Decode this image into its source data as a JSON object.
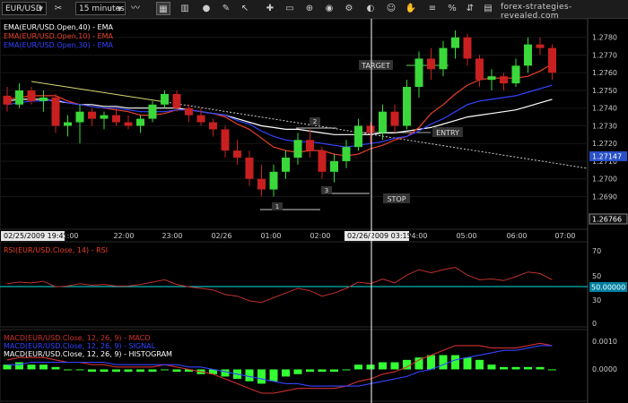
{
  "toolbar": {
    "symbol": "EUR/USD",
    "interval": "15 minutes",
    "site": "forex-strategies-revealed.com",
    "buttons": [
      "scissors-icon",
      "bar-chart-icon",
      "candles-icon",
      "line-chart-icon",
      "pin-icon",
      "cursor-icon",
      "crosshair-icon",
      "pencil-icon",
      "trash-icon",
      "image-icon",
      "zoom-icon",
      "gear-icon",
      "alarm-icon",
      "person-icon",
      "hand-icon",
      "bars-icon",
      "percent-icon",
      "up-down-arrows-icon",
      "grid-icon",
      "tree-icon"
    ]
  },
  "price_panel": {
    "legend": [
      "EMA(EUR/USD.Open,40) - EMA",
      "EMA(EUR/USD.Open,10) - EMA",
      "EMA(EUR/USD.Open,30) - EMA"
    ],
    "legend_colors": [
      "#ffffff",
      "#e8402a",
      "#3344ff"
    ],
    "current_price": "1.27147",
    "bottom_price": "1.26766",
    "annotations": {
      "target": "TARGET",
      "entry": "ENTRY",
      "stop": "STOP",
      "label1": "1",
      "label2": "2",
      "label3": "3"
    }
  },
  "time_axis": {
    "labels": [
      "21:00",
      "22:00",
      "23:00",
      "02/26",
      "01:00",
      "02:00",
      "04:00",
      "05:00",
      "06:00",
      "07:00"
    ],
    "start_box": "02/25/2009 19:45",
    "cursor_box": "02/26/2009 03:15"
  },
  "rsi_panel": {
    "title": "RSI(EUR/USD.Close, 14) - RSI",
    "ticks": [
      "70",
      "50",
      "30",
      "0"
    ],
    "level_value": "50.00000",
    "level_color": "#00e5e5"
  },
  "macd_panel": {
    "title_macd": "MACD(EUR/USD.Close, 12, 26, 9) - MACD",
    "title_signal": "MACD(EUR/USD.Close, 12, 26, 9) - SIGNAL",
    "title_hist": "MACD(EUR/USD.Close, 12, 26, 9) - HISTOGRAM",
    "ticks": [
      "0.0010",
      "0.0000"
    ],
    "colors": {
      "macd": "#d03030",
      "signal": "#3344ff",
      "histogram": "#33ff33"
    }
  },
  "chart_data": [
    {
      "type": "candlestick",
      "title": "EUR/USD",
      "ylim": [
        1.2672,
        1.279
      ],
      "y_ticks": [
        1.269,
        1.27,
        1.271,
        1.272,
        1.273,
        1.274,
        1.275,
        1.276,
        1.277,
        1.278
      ],
      "candles": [
        {
          "o": 1.2747,
          "h": 1.2752,
          "l": 1.2738,
          "c": 1.2742
        },
        {
          "o": 1.2742,
          "h": 1.2754,
          "l": 1.274,
          "c": 1.275
        },
        {
          "o": 1.275,
          "h": 1.2752,
          "l": 1.2742,
          "c": 1.2744
        },
        {
          "o": 1.2744,
          "h": 1.275,
          "l": 1.2738,
          "c": 1.2746
        },
        {
          "o": 1.2746,
          "h": 1.2748,
          "l": 1.2726,
          "c": 1.273
        },
        {
          "o": 1.273,
          "h": 1.2736,
          "l": 1.2724,
          "c": 1.2732
        },
        {
          "o": 1.2732,
          "h": 1.2742,
          "l": 1.272,
          "c": 1.2738
        },
        {
          "o": 1.2738,
          "h": 1.274,
          "l": 1.273,
          "c": 1.2734
        },
        {
          "o": 1.2734,
          "h": 1.2738,
          "l": 1.2728,
          "c": 1.2736
        },
        {
          "o": 1.2736,
          "h": 1.274,
          "l": 1.273,
          "c": 1.2732
        },
        {
          "o": 1.2732,
          "h": 1.2736,
          "l": 1.2728,
          "c": 1.273
        },
        {
          "o": 1.273,
          "h": 1.2736,
          "l": 1.2726,
          "c": 1.2734
        },
        {
          "o": 1.2734,
          "h": 1.2744,
          "l": 1.2732,
          "c": 1.2742
        },
        {
          "o": 1.2742,
          "h": 1.275,
          "l": 1.274,
          "c": 1.2748
        },
        {
          "o": 1.2748,
          "h": 1.275,
          "l": 1.2738,
          "c": 1.274
        },
        {
          "o": 1.274,
          "h": 1.2742,
          "l": 1.2732,
          "c": 1.2736
        },
        {
          "o": 1.2736,
          "h": 1.274,
          "l": 1.273,
          "c": 1.2732
        },
        {
          "o": 1.2732,
          "h": 1.2734,
          "l": 1.2724,
          "c": 1.2728
        },
        {
          "o": 1.2728,
          "h": 1.273,
          "l": 1.2712,
          "c": 1.2716
        },
        {
          "o": 1.2716,
          "h": 1.2722,
          "l": 1.2708,
          "c": 1.2712
        },
        {
          "o": 1.2712,
          "h": 1.2716,
          "l": 1.2696,
          "c": 1.27
        },
        {
          "o": 1.27,
          "h": 1.2708,
          "l": 1.269,
          "c": 1.2694
        },
        {
          "o": 1.2694,
          "h": 1.2708,
          "l": 1.269,
          "c": 1.2704
        },
        {
          "o": 1.2704,
          "h": 1.2716,
          "l": 1.27,
          "c": 1.2712
        },
        {
          "o": 1.2712,
          "h": 1.2726,
          "l": 1.2708,
          "c": 1.2722
        },
        {
          "o": 1.2722,
          "h": 1.2728,
          "l": 1.2712,
          "c": 1.2716
        },
        {
          "o": 1.2716,
          "h": 1.2718,
          "l": 1.27,
          "c": 1.2704
        },
        {
          "o": 1.2704,
          "h": 1.2714,
          "l": 1.2698,
          "c": 1.271
        },
        {
          "o": 1.271,
          "h": 1.2722,
          "l": 1.2706,
          "c": 1.2718
        },
        {
          "o": 1.2718,
          "h": 1.2734,
          "l": 1.2716,
          "c": 1.273
        },
        {
          "o": 1.273,
          "h": 1.2732,
          "l": 1.272,
          "c": 1.2726
        },
        {
          "o": 1.2726,
          "h": 1.2742,
          "l": 1.2722,
          "c": 1.2738
        },
        {
          "o": 1.2738,
          "h": 1.2742,
          "l": 1.2726,
          "c": 1.273
        },
        {
          "o": 1.273,
          "h": 1.2756,
          "l": 1.2728,
          "c": 1.2752
        },
        {
          "o": 1.2752,
          "h": 1.2772,
          "l": 1.2746,
          "c": 1.2768
        },
        {
          "o": 1.2768,
          "h": 1.2774,
          "l": 1.2756,
          "c": 1.2762
        },
        {
          "o": 1.2762,
          "h": 1.2778,
          "l": 1.2758,
          "c": 1.2774
        },
        {
          "o": 1.2774,
          "h": 1.2784,
          "l": 1.2768,
          "c": 1.278
        },
        {
          "o": 1.278,
          "h": 1.2782,
          "l": 1.2764,
          "c": 1.2768
        },
        {
          "o": 1.2768,
          "h": 1.277,
          "l": 1.2752,
          "c": 1.2756
        },
        {
          "o": 1.2756,
          "h": 1.2762,
          "l": 1.275,
          "c": 1.2758
        },
        {
          "o": 1.2758,
          "h": 1.276,
          "l": 1.275,
          "c": 1.2754
        },
        {
          "o": 1.2754,
          "h": 1.2768,
          "l": 1.2752,
          "c": 1.2764
        },
        {
          "o": 1.2764,
          "h": 1.278,
          "l": 1.276,
          "c": 1.2776
        },
        {
          "o": 1.2776,
          "h": 1.278,
          "l": 1.277,
          "c": 1.2774
        },
        {
          "o": 1.2774,
          "h": 1.2776,
          "l": 1.2756,
          "c": 1.276
        }
      ],
      "series": [
        {
          "name": "EMA(EUR/USD.Open,40) - EMA",
          "values": [
            1.2744,
            1.2745,
            1.2745,
            1.2745,
            1.2744,
            1.2743,
            1.2742,
            1.2742,
            1.2741,
            1.2741,
            1.274,
            1.274,
            1.274,
            1.274,
            1.274,
            1.2739,
            1.2738,
            1.2737,
            1.2736,
            1.2734,
            1.2732,
            1.273,
            1.2729,
            1.2728,
            1.2728,
            1.2727,
            1.2726,
            1.2725,
            1.2725,
            1.2725,
            1.2725,
            1.2726,
            1.2726,
            1.2727,
            1.2728,
            1.2729,
            1.2731,
            1.2733,
            1.2735,
            1.2736,
            1.2737,
            1.2738,
            1.2739,
            1.2741,
            1.2743,
            1.2745
          ]
        },
        {
          "name": "EMA(EUR/USD.Open,10) - EMA",
          "values": [
            1.2745,
            1.2746,
            1.2747,
            1.2747,
            1.2747,
            1.2744,
            1.2742,
            1.2741,
            1.274,
            1.2739,
            1.2738,
            1.2736,
            1.2736,
            1.2737,
            1.2739,
            1.2739,
            1.2738,
            1.2737,
            1.2735,
            1.2731,
            1.2728,
            1.2723,
            1.2718,
            1.2716,
            1.2715,
            1.2716,
            1.2716,
            1.2714,
            1.2713,
            1.2714,
            1.2717,
            1.2719,
            1.2722,
            1.2724,
            1.2729,
            1.2737,
            1.2742,
            1.2748,
            1.2753,
            1.2756,
            1.2757,
            1.2757,
            1.2757,
            1.2758,
            1.2761,
            1.2765
          ]
        },
        {
          "name": "EMA(EUR/USD.Open,30) - EMA",
          "values": [
            1.2742,
            1.2743,
            1.2744,
            1.2744,
            1.2745,
            1.2743,
            1.2742,
            1.2741,
            1.274,
            1.274,
            1.2739,
            1.2738,
            1.2738,
            1.2738,
            1.2739,
            1.2739,
            1.2738,
            1.2737,
            1.2736,
            1.2733,
            1.2731,
            1.2727,
            1.2724,
            1.2722,
            1.2721,
            1.2721,
            1.272,
            1.2719,
            1.2718,
            1.2719,
            1.272,
            1.2721,
            1.2723,
            1.2724,
            1.2727,
            1.2731,
            1.2734,
            1.2738,
            1.2742,
            1.2744,
            1.2745,
            1.2746,
            1.2747,
            1.2749,
            1.2751,
            1.2753
          ]
        }
      ]
    },
    {
      "type": "line",
      "title": "RSI(EUR/USD.Close, 14) - RSI",
      "ylim": [
        0,
        100
      ],
      "series": [
        {
          "name": "RSI(EUR/USD.Close, 14) - RSI",
          "values": [
            52,
            54,
            53,
            55,
            48,
            49,
            52,
            50,
            51,
            49,
            49,
            51,
            54,
            57,
            51,
            48,
            46,
            44,
            38,
            36,
            30,
            28,
            34,
            40,
            46,
            43,
            36,
            40,
            46,
            54,
            52,
            58,
            53,
            63,
            70,
            66,
            70,
            73,
            63,
            57,
            58,
            56,
            61,
            67,
            65,
            57
          ]
        }
      ]
    },
    {
      "type": "bar+line",
      "title": "MACD(EUR/USD.Close, 12, 26, 9)",
      "ylim": [
        -0.0013,
        0.0016
      ],
      "series": [
        {
          "name": "MACD(EUR/USD.Close, 12, 26, 9) - MACD",
          "values": [
            0.0004,
            0.0005,
            0.0005,
            0.0005,
            0.0004,
            0.0003,
            0.0003,
            0.0002,
            0.0002,
            0.0001,
            0.0001,
            0.0001,
            0.0001,
            0.0002,
            0.0001,
            0.0,
            -0.0001,
            -0.0002,
            -0.0004,
            -0.0006,
            -0.0008,
            -0.001,
            -0.001,
            -0.0009,
            -0.0008,
            -0.0008,
            -0.0008,
            -0.0008,
            -0.0007,
            -0.0005,
            -0.0004,
            -0.0002,
            -0.0001,
            0.0001,
            0.0004,
            0.0006,
            0.0008,
            0.001,
            0.001,
            0.001,
            0.0009,
            0.0009,
            0.0009,
            0.001,
            0.0011,
            0.001
          ]
        },
        {
          "name": "MACD(EUR/USD.Close, 12, 26, 9) - SIGNAL",
          "values": [
            0.0002,
            0.0002,
            0.0003,
            0.0003,
            0.0003,
            0.0003,
            0.0003,
            0.0003,
            0.0003,
            0.0002,
            0.0002,
            0.0002,
            0.0002,
            0.0002,
            0.0002,
            0.0001,
            0.0001,
            0.0,
            -0.0001,
            -0.0002,
            -0.0003,
            -0.0004,
            -0.0005,
            -0.0006,
            -0.0006,
            -0.0007,
            -0.0007,
            -0.0007,
            -0.0007,
            -0.0007,
            -0.0006,
            -0.0005,
            -0.0004,
            -0.0003,
            -0.0001,
            0.0,
            0.0002,
            0.0004,
            0.0005,
            0.0006,
            0.0007,
            0.0008,
            0.0008,
            0.0009,
            0.001,
            0.001
          ]
        },
        {
          "name": "MACD(EUR/USD.Close, 12, 26, 9) - HISTOGRAM",
          "values": [
            0.0002,
            0.0003,
            0.0002,
            0.0002,
            0.0001,
            0.0,
            0.0,
            -0.0001,
            -0.0001,
            -0.0001,
            -0.0001,
            -0.0001,
            -0.0001,
            0.0,
            -0.0001,
            -0.0001,
            -0.0002,
            -0.0002,
            -0.0003,
            -0.0004,
            -0.0005,
            -0.0006,
            -0.0005,
            -0.0003,
            -0.0002,
            -0.0001,
            -0.0001,
            -0.0001,
            0.0,
            0.0002,
            0.0002,
            0.0003,
            0.0003,
            0.0004,
            0.0005,
            0.0006,
            0.0006,
            0.0006,
            0.0005,
            0.0004,
            0.0002,
            0.0001,
            0.0001,
            0.0001,
            0.0001,
            0.0
          ]
        }
      ]
    }
  ]
}
